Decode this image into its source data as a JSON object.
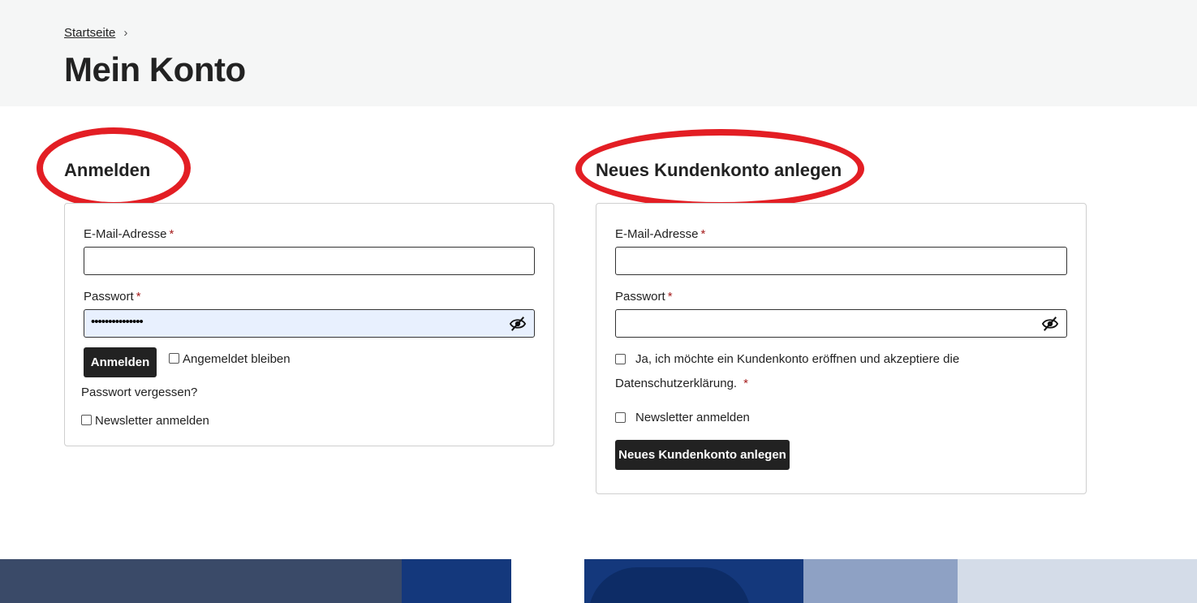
{
  "breadcrumb": {
    "home": "Startseite",
    "separator": "›"
  },
  "page_title": "Mein Konto",
  "login": {
    "heading": "Anmelden",
    "email_label": "E-Mail-Adresse",
    "email_required": "*",
    "email_value": "",
    "password_label": "Passwort",
    "password_required": "*",
    "password_value": "•••••••••••••••",
    "submit_label": "Anmelden",
    "remember_label": "Angemeldet bleiben",
    "forgot_label": "Passwort vergessen?",
    "newsletter_label": "Newsletter anmelden"
  },
  "register": {
    "heading": "Neues Kundenkonto anlegen",
    "email_label": "E-Mail-Adresse",
    "email_required": "*",
    "email_value": "",
    "password_label": "Passwort",
    "password_required": "*",
    "password_value": "",
    "consent_line1": "Ja, ich möchte ein Kundenkonto eröffnen und akzeptiere die",
    "consent_line2": "Datenschutzerklärung.",
    "consent_required": "*",
    "newsletter_label": "Newsletter anmelden",
    "submit_label": "Neues Kundenkonto anlegen"
  },
  "annotation_color": "#e31e24",
  "icons": {
    "password_toggle": "eye-slash-icon",
    "breadcrumb_separator": "chevron-right-icon"
  }
}
